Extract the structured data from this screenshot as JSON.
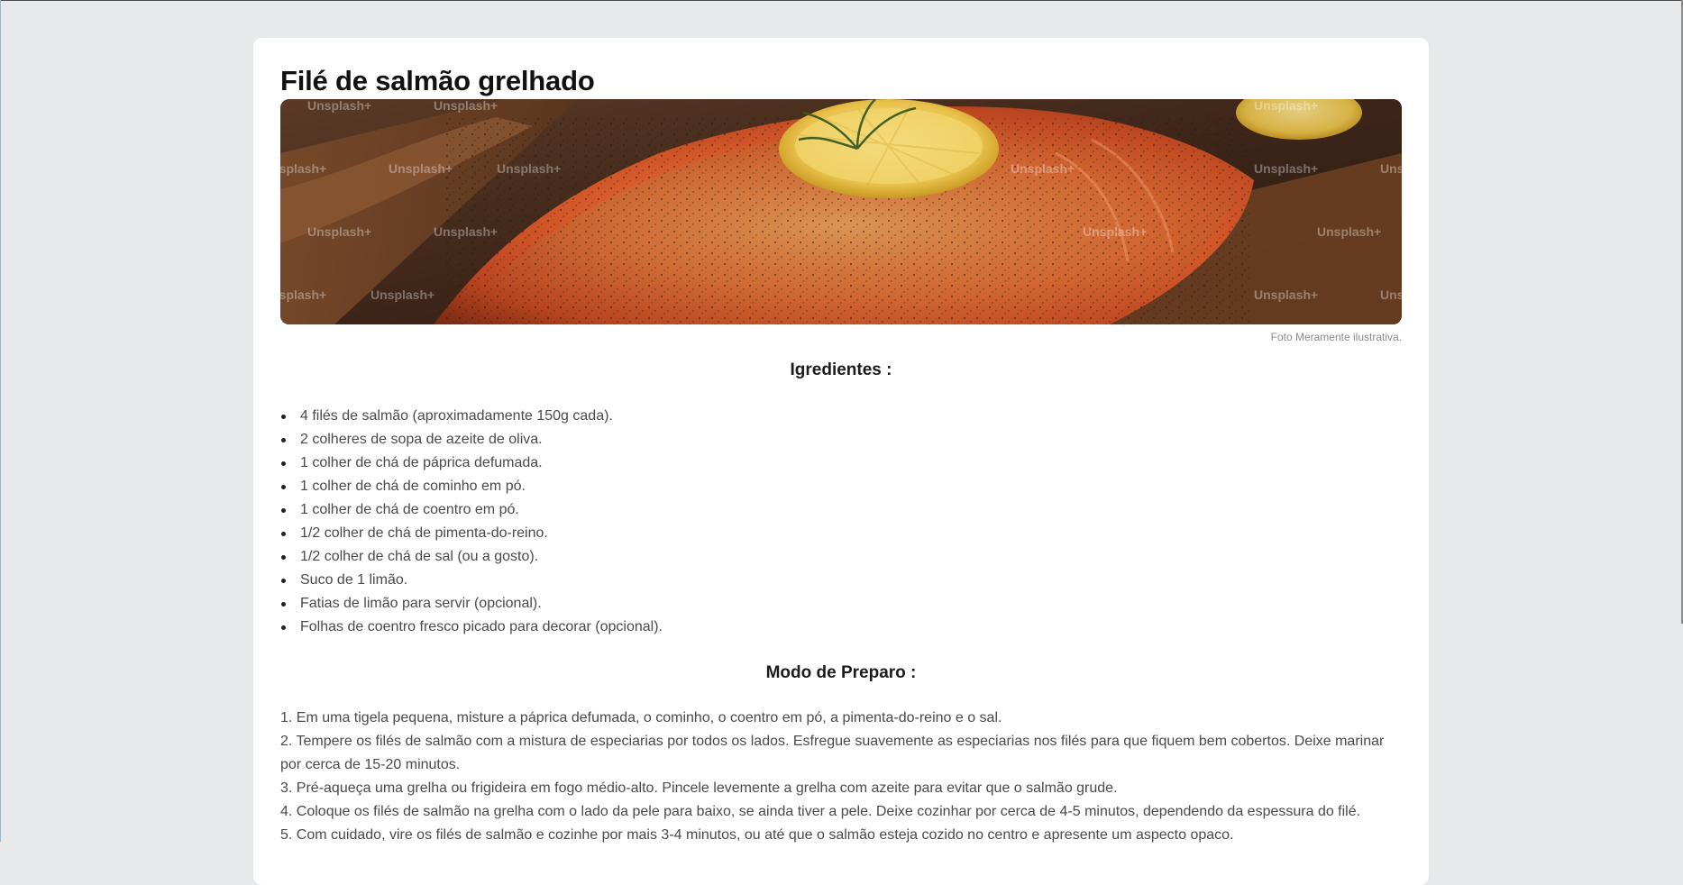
{
  "recipe": {
    "title": "Filé de salmão grelhado",
    "image_caption": "Foto Meramente ilustrativa.",
    "image_watermark": "Unsplash+"
  },
  "ingredients": {
    "heading": "Igredientes :",
    "items": [
      "4 filés de salmão (aproximadamente 150g cada).",
      "2 colheres de sopa de azeite de oliva.",
      "1 colher de chá de páprica defumada.",
      "1 colher de chá de cominho em pó.",
      "1 colher de chá de coentro em pó.",
      "1/2 colher de chá de pimenta-do-reino.",
      "1/2 colher de chá de sal (ou a gosto).",
      "Suco de 1 limão.",
      "Fatias de limão para servir (opcional).",
      "Folhas de coentro fresco picado para decorar (opcional)."
    ]
  },
  "method": {
    "heading": "Modo de Preparo :",
    "steps": [
      "1. Em uma tigela pequena, misture a páprica defumada, o cominho, o coentro em pó, a pimenta-do-reino e o sal.",
      "2. Tempere os filés de salmão com a mistura de especiarias por todos os lados. Esfregue suavemente as especiarias nos filés para que fiquem bem cobertos. Deixe marinar por cerca de 15-20 minutos.",
      "3. Pré-aqueça uma grelha ou frigideira em fogo médio-alto. Pincele levemente a grelha com azeite para evitar que o salmão grude.",
      "4. Coloque os filés de salmão na grelha com o lado da pele para baixo, se ainda tiver a pele. Deixe cozinhar por cerca de 4-5 minutos, dependendo da espessura do filé.",
      "5. Com cuidado, vire os filés de salmão e cozinhe por mais 3-4 minutos, ou até que o salmão esteja cozido no centro e apresente um aspecto opaco."
    ]
  },
  "colors": {
    "page_background": "#e8e9ea",
    "card_background": "#ffffff",
    "title_text": "#111111",
    "body_text": "#4a4a4a",
    "caption_text": "#8a8a8a"
  }
}
